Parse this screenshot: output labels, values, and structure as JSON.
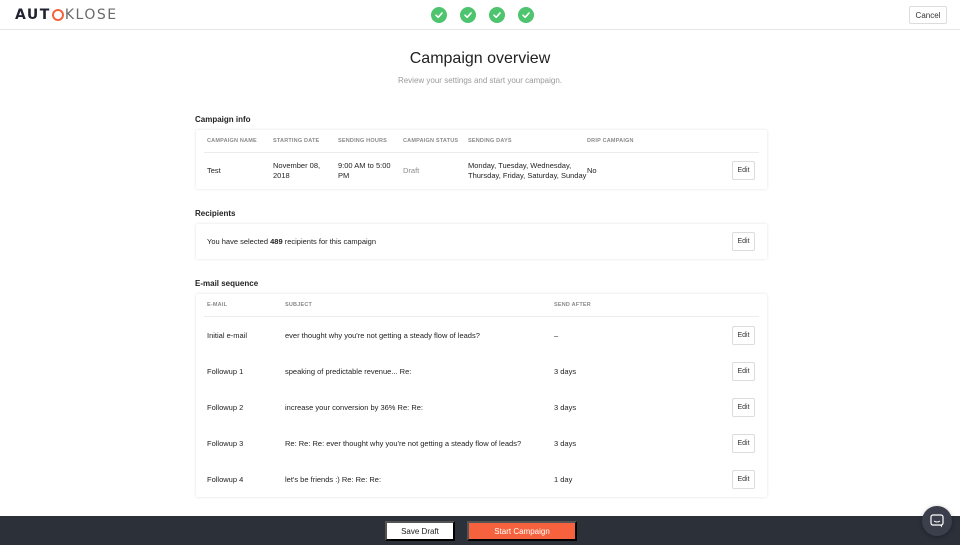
{
  "header": {
    "logo_left": "AUT",
    "logo_mid": "K",
    "logo_right": "LOSE",
    "steps": [
      "check",
      "check",
      "check",
      "check"
    ],
    "cancel_label": "Cancel"
  },
  "page": {
    "title": "Campaign overview",
    "subtitle": "Review your settings and start your campaign."
  },
  "campaign_info": {
    "section_title": "Campaign info",
    "columns": [
      "Campaign name",
      "Starting date",
      "Sending hours",
      "Campaign status",
      "Sending days",
      "Drip campaign"
    ],
    "row": {
      "name": "Test",
      "starting_date_line1": "November 08,",
      "starting_date_line2": "2018",
      "sending_hours_line1": "9:00 AM to 5:00",
      "sending_hours_line2": "PM",
      "status": "Draft",
      "sending_days_line1": "Monday, Tuesday, Wednesday,",
      "sending_days_line2": "Thursday, Friday, Saturday, Sunday",
      "drip": "No"
    },
    "edit_label": "Edit"
  },
  "recipients": {
    "section_title": "Recipients",
    "text_before": "You have selected ",
    "count": "489",
    "text_after": " recipients for this campaign",
    "edit_label": "Edit"
  },
  "email_sequence": {
    "section_title": "E-mail sequence",
    "columns": [
      "E-mail",
      "Subject",
      "Send after"
    ],
    "rows": [
      {
        "email": "Initial e-mail",
        "subject": "ever thought why you're not getting a steady flow of leads?",
        "send_after": "–"
      },
      {
        "email": "Followup 1",
        "subject": "speaking of predictable revenue... Re:",
        "send_after": "3 days"
      },
      {
        "email": "Followup 2",
        "subject": "increase your conversion by 36% Re: Re:",
        "send_after": "3 days"
      },
      {
        "email": "Followup 3",
        "subject": "Re: Re: Re: ever thought why you're not getting a steady flow of leads?",
        "send_after": "3 days"
      },
      {
        "email": "Followup 4",
        "subject": "let's be friends :) Re: Re: Re:",
        "send_after": "1 day"
      }
    ],
    "edit_label": "Edit"
  },
  "footer": {
    "save_draft_label": "Save Draft",
    "start_campaign_label": "Start Campaign"
  },
  "colors": {
    "accent": "#f5623d",
    "step_done": "#4ec46e",
    "footer_bg": "#2b3039"
  }
}
